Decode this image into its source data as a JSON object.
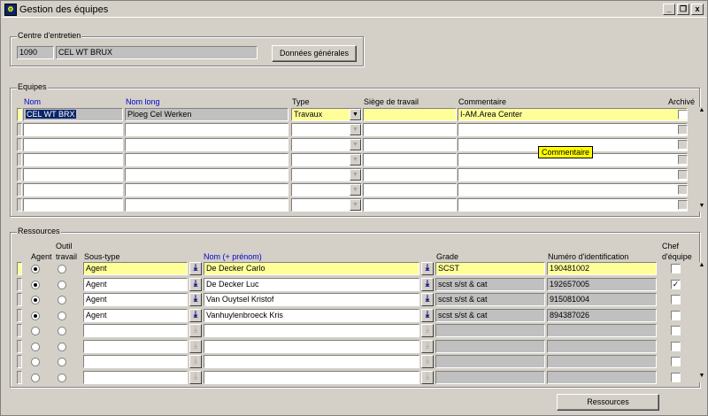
{
  "window": {
    "title": "Gestion des équipes",
    "min": "_",
    "restore": "❐",
    "close": "x"
  },
  "centre": {
    "group_label": "Centre d'entretien",
    "code": "1090",
    "name": "CEL WT BRUX",
    "button": "Données générales"
  },
  "equipes": {
    "group_label": "Equipes",
    "headers": {
      "nom": "Nom",
      "nom_long": "Nom long",
      "type": "Type",
      "siege": "Siège de travail",
      "commentaire": "Commentaire",
      "archive": "Archivé"
    },
    "rows": [
      {
        "nom": "CEL WT BRX",
        "nom_long": "Ploeg Cel Werken",
        "type": "Travaux",
        "siege": "",
        "commentaire": "I-AM.Area Center",
        "archive": false
      },
      {
        "nom": "",
        "nom_long": "",
        "type": "",
        "siege": "",
        "commentaire": "",
        "archive": false
      },
      {
        "nom": "",
        "nom_long": "",
        "type": "",
        "siege": "",
        "commentaire": "",
        "archive": false
      },
      {
        "nom": "",
        "nom_long": "",
        "type": "",
        "siege": "",
        "commentaire": "",
        "archive": false
      },
      {
        "nom": "",
        "nom_long": "",
        "type": "",
        "siege": "",
        "commentaire": "",
        "archive": false
      },
      {
        "nom": "",
        "nom_long": "",
        "type": "",
        "siege": "",
        "commentaire": "",
        "archive": false
      },
      {
        "nom": "",
        "nom_long": "",
        "type": "",
        "siege": "",
        "commentaire": "",
        "archive": false
      }
    ],
    "tooltip": "Commentaire"
  },
  "ressources": {
    "group_label": "Ressources",
    "headers": {
      "agent": "Agent",
      "outil1": "Outil",
      "outil2": "travail",
      "sous_type": "Sous-type",
      "nom": "Nom (+ prénom)",
      "grade": "Grade",
      "numero": "Numéro d'identification",
      "chef1": "Chef",
      "chef2": "d'équipe"
    },
    "rows": [
      {
        "sous_type": "Agent",
        "nom": "De Decker Carlo",
        "grade": "SCST",
        "numero": "190481002",
        "chef": false
      },
      {
        "sous_type": "Agent",
        "nom": "De Decker Luc",
        "grade": "scst s/st & cat",
        "numero": "192657005",
        "chef": true
      },
      {
        "sous_type": "Agent",
        "nom": "Van Ouytsel Kristof",
        "grade": "scst s/st & cat",
        "numero": "915081004",
        "chef": false
      },
      {
        "sous_type": "Agent",
        "nom": "Vanhuylenbroeck Kris",
        "grade": "scst s/st & cat",
        "numero": "894387026",
        "chef": false
      },
      {
        "sous_type": "",
        "nom": "",
        "grade": "",
        "numero": "",
        "chef": false
      },
      {
        "sous_type": "",
        "nom": "",
        "grade": "",
        "numero": "",
        "chef": false
      },
      {
        "sous_type": "",
        "nom": "",
        "grade": "",
        "numero": "",
        "chef": false
      },
      {
        "sous_type": "",
        "nom": "",
        "grade": "",
        "numero": "",
        "chef": false
      }
    ],
    "button": "Ressources"
  },
  "colors": {
    "current_row": "#ffff99",
    "selection": "#0a246a",
    "link_header": "#0000cc"
  }
}
